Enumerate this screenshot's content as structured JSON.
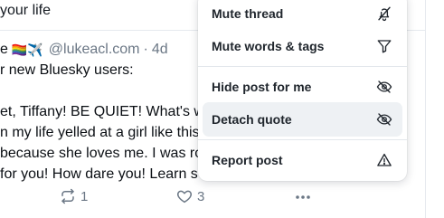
{
  "feed": {
    "previous_post_tail": "your life",
    "post": {
      "name_tail": "e",
      "emoji": "🏳️‍🌈✈️",
      "handle": "@lukeacl.com",
      "separator": "·",
      "time": "4d",
      "lines": [
        "r new Bluesky users:",
        "",
        "et, Tiffany! BE QUIET! What's wr",
        "n my life yelled at a girl like this.",
        "because she loves me. I was ro",
        "for you! How dare you! Learn s"
      ],
      "reposts": "1",
      "likes": "3"
    }
  },
  "menu": {
    "items": [
      {
        "label": "Mute thread",
        "icon": "muted-bell-icon"
      },
      {
        "label": "Mute words & tags",
        "icon": "filter-icon"
      },
      {
        "label": "Hide post for me",
        "icon": "eye-slash-icon"
      },
      {
        "label": "Detach quote",
        "icon": "eye-slash-icon",
        "highlighted": true
      },
      {
        "label": "Report post",
        "icon": "warning-triangle-icon"
      }
    ]
  },
  "colors": {
    "muted_text": "#6b7785",
    "menu_label": "#20262d",
    "menu_hover": "#eef1f4"
  }
}
